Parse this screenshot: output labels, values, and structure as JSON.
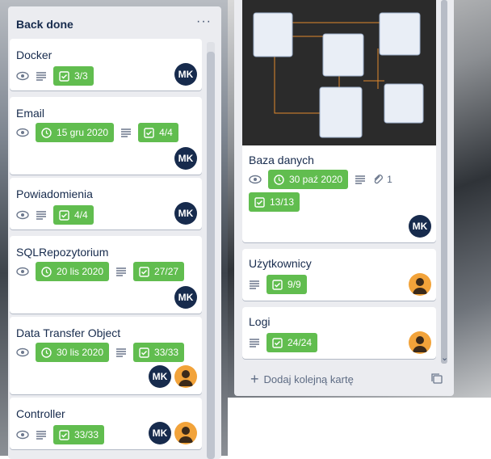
{
  "lists": [
    {
      "title": "Back done",
      "cards": [
        {
          "title": "Docker",
          "checklist": "3/3",
          "avatars": [
            "MK"
          ]
        },
        {
          "title": "Email",
          "due": "15 gru 2020",
          "checklist": "4/4",
          "avatars": [
            "MK"
          ]
        },
        {
          "title": "Powiadomienia",
          "checklist": "4/4",
          "avatars": [
            "MK"
          ]
        },
        {
          "title": "SQLRepozytorium",
          "due": "20 lis 2020",
          "checklist": "27/27",
          "avatars": [
            "MK"
          ]
        },
        {
          "title": "Data Transfer Object",
          "due": "30 lis 2020",
          "checklist": "33/33",
          "avatars": [
            "MK",
            "person"
          ]
        },
        {
          "title": "Controller",
          "checklist": "33/33",
          "avatars": [
            "MK",
            "person"
          ]
        }
      ]
    },
    {
      "cards": [
        {
          "title": "Baza danych",
          "due": "30 paź 2020",
          "attachments": "1",
          "checklist": "13/13",
          "avatars": [
            "MK"
          ]
        },
        {
          "title": "Użytkownicy",
          "checklist": "9/9",
          "avatars": [
            "person"
          ]
        },
        {
          "title": "Logi",
          "checklist": "24/24",
          "avatars": [
            "person"
          ]
        }
      ],
      "add_card_label": "Dodaj kolejną kartę"
    }
  ],
  "avatar_initials": "MK",
  "colors": {
    "list_bg": "#ebecf0",
    "badge_green": "#61bd4f",
    "avatar_dark": "#172b4d",
    "avatar_orange": "#f2a33a",
    "text": "#172b4d"
  }
}
